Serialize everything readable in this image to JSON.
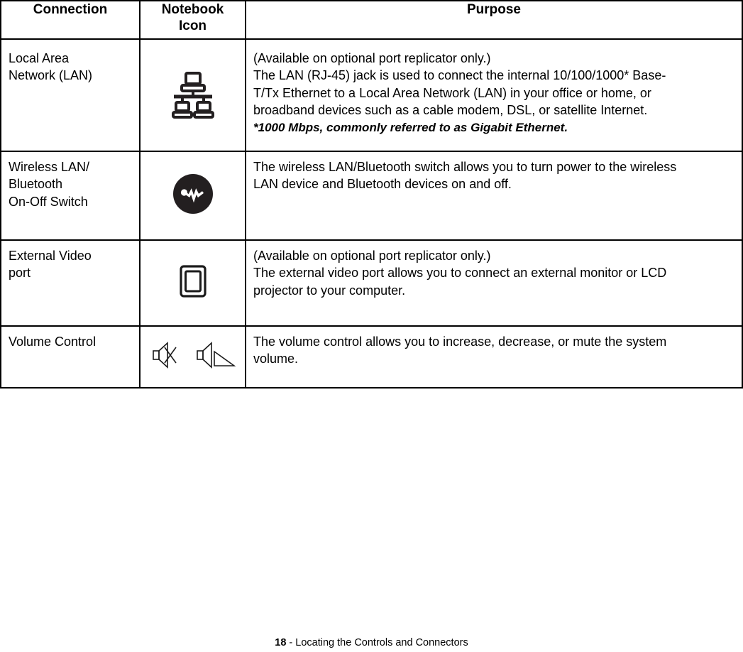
{
  "document": {
    "table": {
      "headers": [
        {
          "label": "Connection",
          "name": "connection"
        },
        {
          "label": "Notebook\nIcon",
          "name": "notebook-icon"
        },
        {
          "label": "Purpose",
          "name": "purpose"
        }
      ],
      "header_labels": {
        "connection": "Connection",
        "notebook_icon_line1": "Notebook",
        "notebook_icon_line2": "Icon",
        "purpose": "Purpose"
      },
      "rows": [
        {
          "connection_lines": [
            "Local Area",
            "Network (LAN)"
          ],
          "icon": "lan-network-icon",
          "purpose_lines": [
            "(Available on optional port replicator only.)",
            "The LAN (RJ-45) jack is used to connect the internal 10/100/1000* Base-",
            "T/Tx Ethernet to a Local Area Network (LAN) in your office or home, or",
            "broadband devices such as a cable modem, DSL, or satellite Internet."
          ],
          "purpose_footnote": "*1000 Mbps, commonly referred to as Gigabit Ethernet."
        },
        {
          "connection_lines": [
            "Wireless LAN/",
            "Bluetooth",
            "On-Off Switch"
          ],
          "icon": "wireless-switch-icon",
          "purpose_lines": [
            "The wireless LAN/Bluetooth switch allows you to turn power to the wireless",
            "LAN device and Bluetooth devices on and off."
          ],
          "purpose_footnote": ""
        },
        {
          "connection_lines": [
            "External Video",
            "port"
          ],
          "icon": "external-video-port-icon",
          "purpose_lines": [
            "(Available on optional port replicator only.)",
            "The external video port allows you to connect an external monitor or LCD",
            "projector to your computer."
          ],
          "purpose_footnote": ""
        },
        {
          "connection_lines": [
            "Volume Control"
          ],
          "icon": "volume-mute-and-speaker-icons",
          "purpose_lines": [
            "The volume control allows you to increase, decrease, or mute the system",
            "volume."
          ],
          "purpose_footnote": ""
        }
      ]
    },
    "footer": {
      "page_number": "18",
      "separator": " - ",
      "title": "Locating the Controls and Connectors"
    },
    "colors": {
      "text": "#000000",
      "border": "#000000",
      "background": "#ffffff",
      "icon_fill": "#231f20"
    }
  }
}
